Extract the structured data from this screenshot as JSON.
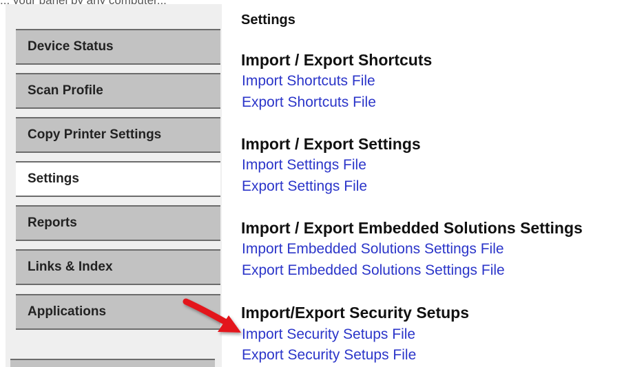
{
  "cropped_top_text": "... your panel by any computer...",
  "sidebar": {
    "items": [
      {
        "label": "Device Status",
        "active": false
      },
      {
        "label": "Scan Profile",
        "active": false
      },
      {
        "label": "Copy Printer Settings",
        "active": false
      },
      {
        "label": "Settings",
        "active": true
      },
      {
        "label": "Reports",
        "active": false
      },
      {
        "label": "Links & Index",
        "active": false
      },
      {
        "label": "Applications",
        "active": false
      }
    ]
  },
  "main": {
    "title": "Settings",
    "sections": [
      {
        "title": "Import / Export Shortcuts",
        "links": [
          "Import Shortcuts File",
          "Export Shortcuts File"
        ]
      },
      {
        "title": "Import / Export Settings",
        "links": [
          "Import Settings File",
          "Export Settings File"
        ]
      },
      {
        "title": "Import / Export Embedded Solutions Settings",
        "links": [
          "Import Embedded Solutions Settings File",
          "Export Embedded Solutions Settings File"
        ]
      },
      {
        "title": "Import/Export Security Setups",
        "links": [
          "Import Security Setups File",
          "Export Security Setups File"
        ]
      }
    ]
  },
  "annotation": {
    "icon": "red-arrow-icon",
    "color": "#e3141b"
  },
  "colors": {
    "link": "#2b35c9",
    "nav_bg": "#c2c2c2",
    "nav_active_bg": "#ffffff",
    "sidebar_bg": "#efefef"
  }
}
